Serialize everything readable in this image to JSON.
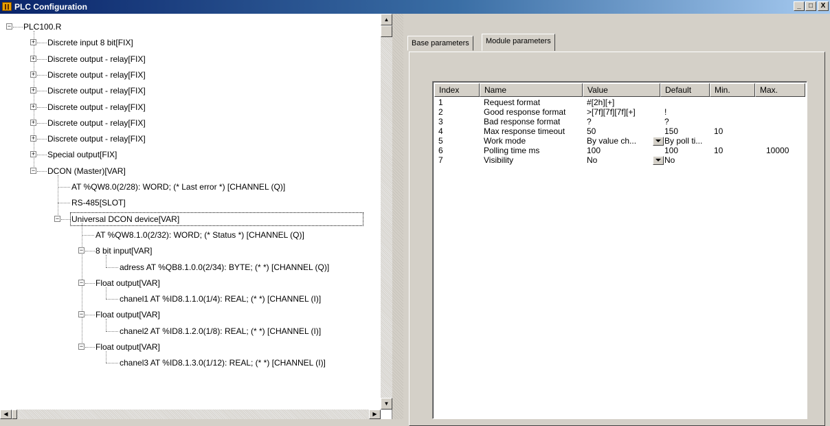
{
  "window": {
    "title": "PLC Configuration",
    "minimize": "_",
    "maximize": "□",
    "close": "X"
  },
  "tree": {
    "rows": [
      {
        "label": "PLC100.R",
        "indent": 0,
        "toggle": "-"
      },
      {
        "label": "Discrete input 8 bit[FIX]",
        "indent": 1,
        "toggle": "+"
      },
      {
        "label": "Discrete output - relay[FIX]",
        "indent": 1,
        "toggle": "+"
      },
      {
        "label": "Discrete output - relay[FIX]",
        "indent": 1,
        "toggle": "+"
      },
      {
        "label": "Discrete output - relay[FIX]",
        "indent": 1,
        "toggle": "+"
      },
      {
        "label": "Discrete output - relay[FIX]",
        "indent": 1,
        "toggle": "+"
      },
      {
        "label": "Discrete output - relay[FIX]",
        "indent": 1,
        "toggle": "+"
      },
      {
        "label": "Discrete output - relay[FIX]",
        "indent": 1,
        "toggle": "+"
      },
      {
        "label": "Special output[FIX]",
        "indent": 1,
        "toggle": "+"
      },
      {
        "label": "DCON (Master)[VAR]",
        "indent": 1,
        "toggle": "-"
      },
      {
        "label": "AT %QW8.0(2/28): WORD; (* Last error *) [CHANNEL (Q)]",
        "indent": 2,
        "toggle": ""
      },
      {
        "label": "RS-485[SLOT]",
        "indent": 2,
        "toggle": ""
      },
      {
        "label": "Universal DCON device[VAR]",
        "indent": 2,
        "toggle": "-",
        "selected": true
      },
      {
        "label": "AT %QW8.1.0(2/32): WORD; (* Status *) [CHANNEL (Q)]",
        "indent": 3,
        "toggle": ""
      },
      {
        "label": "8 bit input[VAR]",
        "indent": 3,
        "toggle": "-"
      },
      {
        "label": "adress AT %QB8.1.0.0(2/34): BYTE; (* *) [CHANNEL (Q)]",
        "indent": 4,
        "toggle": ""
      },
      {
        "label": "Float output[VAR]",
        "indent": 3,
        "toggle": "-"
      },
      {
        "label": "chanel1 AT %ID8.1.1.0(1/4): REAL; (* *) [CHANNEL (I)]",
        "indent": 4,
        "toggle": ""
      },
      {
        "label": "Float output[VAR]",
        "indent": 3,
        "toggle": "-"
      },
      {
        "label": "chanel2 AT %ID8.1.2.0(1/8): REAL; (* *) [CHANNEL (I)]",
        "indent": 4,
        "toggle": ""
      },
      {
        "label": "Float output[VAR]",
        "indent": 3,
        "toggle": "-"
      },
      {
        "label": "chanel3 AT %ID8.1.3.0(1/12): REAL; (* *) [CHANNEL (I)]",
        "indent": 4,
        "toggle": ""
      }
    ]
  },
  "tabs": {
    "base": "Base parameters",
    "module": "Module parameters"
  },
  "grid": {
    "headers": [
      "Index",
      "Name",
      "Value",
      "Default",
      "Min.",
      "Max."
    ],
    "rows": [
      {
        "index": "1",
        "name": "Request format",
        "value": "#[2h][+]",
        "default": "",
        "min": "",
        "max": "",
        "dropdown": false
      },
      {
        "index": "2",
        "name": "Good response format",
        "value": ">[7f][7f][7f][+]",
        "default": "!",
        "min": "",
        "max": "",
        "dropdown": false
      },
      {
        "index": "3",
        "name": "Bad response format",
        "value": "?",
        "default": "?",
        "min": "",
        "max": "",
        "dropdown": false
      },
      {
        "index": "4",
        "name": "Max response timeout",
        "value": "50",
        "default": "150",
        "min": "10",
        "max": "",
        "dropdown": false
      },
      {
        "index": "5",
        "name": "Work mode",
        "value": "By value ch...",
        "default": "By poll ti...",
        "min": "",
        "max": "",
        "dropdown": true
      },
      {
        "index": "6",
        "name": "Polling time ms",
        "value": "100",
        "default": "100",
        "min": "10",
        "max": "10000",
        "dropdown": false
      },
      {
        "index": "7",
        "name": "Visibility",
        "value": "No",
        "default": "No",
        "min": "",
        "max": "",
        "dropdown": true
      }
    ]
  }
}
